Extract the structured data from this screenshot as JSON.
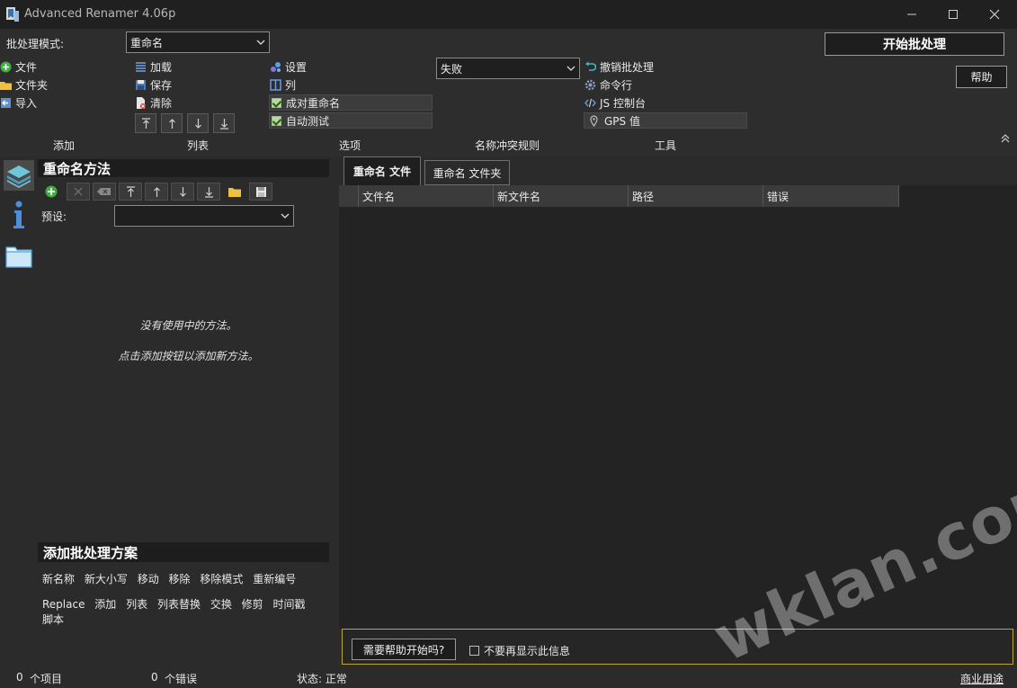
{
  "window": {
    "title": "Advanced Renamer 4.06p"
  },
  "toolbar": {
    "batch_mode_label": "批处理模式:",
    "batch_mode_value": "重命名",
    "add_group": {
      "file": "文件",
      "folder": "文件夹",
      "import": "导入"
    },
    "list_group": {
      "load": "加载",
      "save": "保存",
      "clear": "清除"
    },
    "options_group": {
      "settings": "设置",
      "columns": "列",
      "pair_rename": "成对重命名",
      "auto_test": "自动测试"
    },
    "conflict_value": "失败",
    "tools_group": {
      "undo_batch": "撤销批处理",
      "command_line": "命令行",
      "js_console": "JS 控制台",
      "gps": "GPS 值"
    },
    "start_batch": "开始批处理",
    "help": "帮助",
    "section_labels": {
      "add": "添加",
      "list": "列表",
      "options": "选项",
      "conflict": "名称冲突规则",
      "tools": "工具"
    }
  },
  "methods_panel": {
    "title": "重命名方法",
    "preset_label": "预设:",
    "preset_value": "",
    "empty_line1": "没有使用中的方法。",
    "empty_line2": "点击添加按钮以添加新方法。"
  },
  "batch_panel": {
    "title": "添加批处理方案",
    "row1": [
      "新名称",
      "新大小写",
      "移动",
      "移除",
      "移除模式",
      "重新编号"
    ],
    "row2": [
      "Replace",
      "添加",
      "列表",
      "列表替换",
      "交换",
      "修剪",
      "时间戳",
      "脚本"
    ]
  },
  "tabs": [
    {
      "label": "重命名 文件",
      "active": true
    },
    {
      "label": "重命名 文件夹",
      "active": false
    }
  ],
  "grid": {
    "columns": [
      "文件名",
      "新文件名",
      "路径",
      "错误"
    ]
  },
  "infobar": {
    "button": "需要帮助开始吗?",
    "checkbox_label": "不要再显示此信息"
  },
  "statusbar": {
    "items_count": "0",
    "items_label": "个项目",
    "errors_count": "0",
    "errors_label": "个错误",
    "status": "状态: 正常",
    "commercial": "商业用途"
  },
  "watermark": "wklan.com",
  "colors": {
    "background": "#2b2b2b",
    "titlebar": "#202020",
    "panel_title": "#1d1d1d",
    "info_border": "#b9a733"
  }
}
